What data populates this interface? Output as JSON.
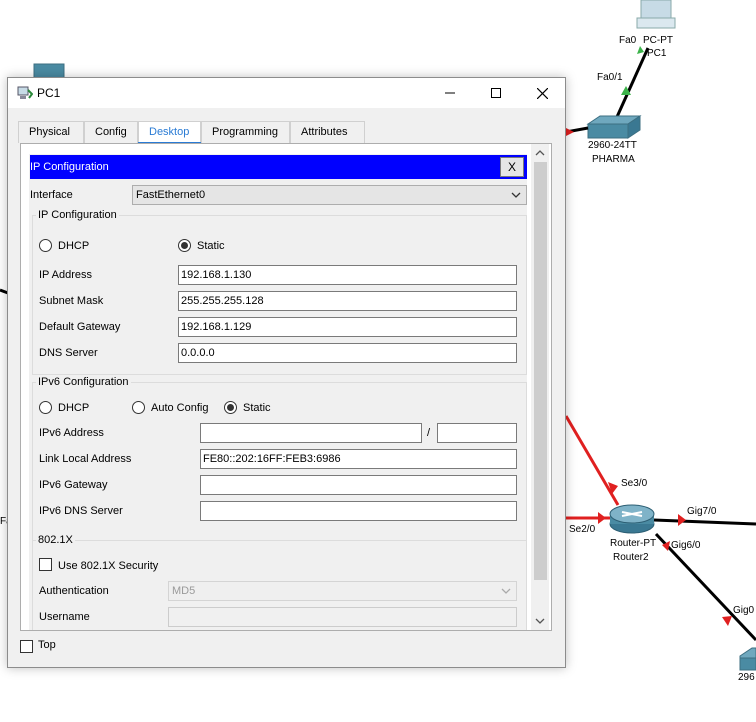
{
  "topology": {
    "pc_label": "PC-PT",
    "pc_name": "PC1",
    "port_fa0": "Fa0",
    "port_fa01": "Fa0/1",
    "switch_model": "2960-24TT",
    "switch_name": "PHARMA",
    "router_model": "Router-PT",
    "router_name": "Router2",
    "port_se30": "Se3/0",
    "port_se20": "Se2/0",
    "port_gig70": "Gig7/0",
    "port_gig60": "Gig6/0",
    "port_gig0_partial": "Gig0",
    "switch2_partial": "296",
    "left_partial": "Fa"
  },
  "window": {
    "title": "PC1",
    "tabs": [
      {
        "label": "Physical"
      },
      {
        "label": "Config"
      },
      {
        "label": "Desktop"
      },
      {
        "label": "Programming"
      },
      {
        "label": "Attributes"
      }
    ],
    "active_tab": "Desktop",
    "top_label": "Top"
  },
  "ip_config": {
    "header": "IP Configuration",
    "close_label": "X",
    "interface_label": "Interface",
    "interface_value": "FastEthernet0",
    "ipv4": {
      "group_title": "IP Configuration",
      "dhcp_label": "DHCP",
      "static_label": "Static",
      "mode": "Static",
      "ip_label": "IP Address",
      "ip_value": "192.168.1.130",
      "mask_label": "Subnet Mask",
      "mask_value": "255.255.255.128",
      "gateway_label": "Default Gateway",
      "gateway_value": "192.168.1.129",
      "dns_label": "DNS Server",
      "dns_value": "0.0.0.0"
    },
    "ipv6": {
      "group_title": "IPv6 Configuration",
      "dhcp_label": "DHCP",
      "auto_label": "Auto Config",
      "static_label": "Static",
      "mode": "Static",
      "address_label": "IPv6 Address",
      "address_value": "",
      "prefix_sep": "/",
      "prefix_value": "",
      "link_local_label": "Link Local Address",
      "link_local_value": "FE80::202:16FF:FEB3:6986",
      "gateway_label": "IPv6 Gateway",
      "gateway_value": "",
      "dns_label": "IPv6 DNS Server",
      "dns_value": ""
    },
    "dot1x": {
      "group_title": "802.1X",
      "use_label": "Use 802.1X Security",
      "auth_label": "Authentication",
      "auth_value": "MD5",
      "username_label": "Username",
      "username_value": ""
    }
  },
  "colors": {
    "header_bar": "#0000ff",
    "active_tab": "#2a7bd4",
    "link_red": "#e02020",
    "link_green": "#3cb34a",
    "cable_black": "#000000"
  }
}
